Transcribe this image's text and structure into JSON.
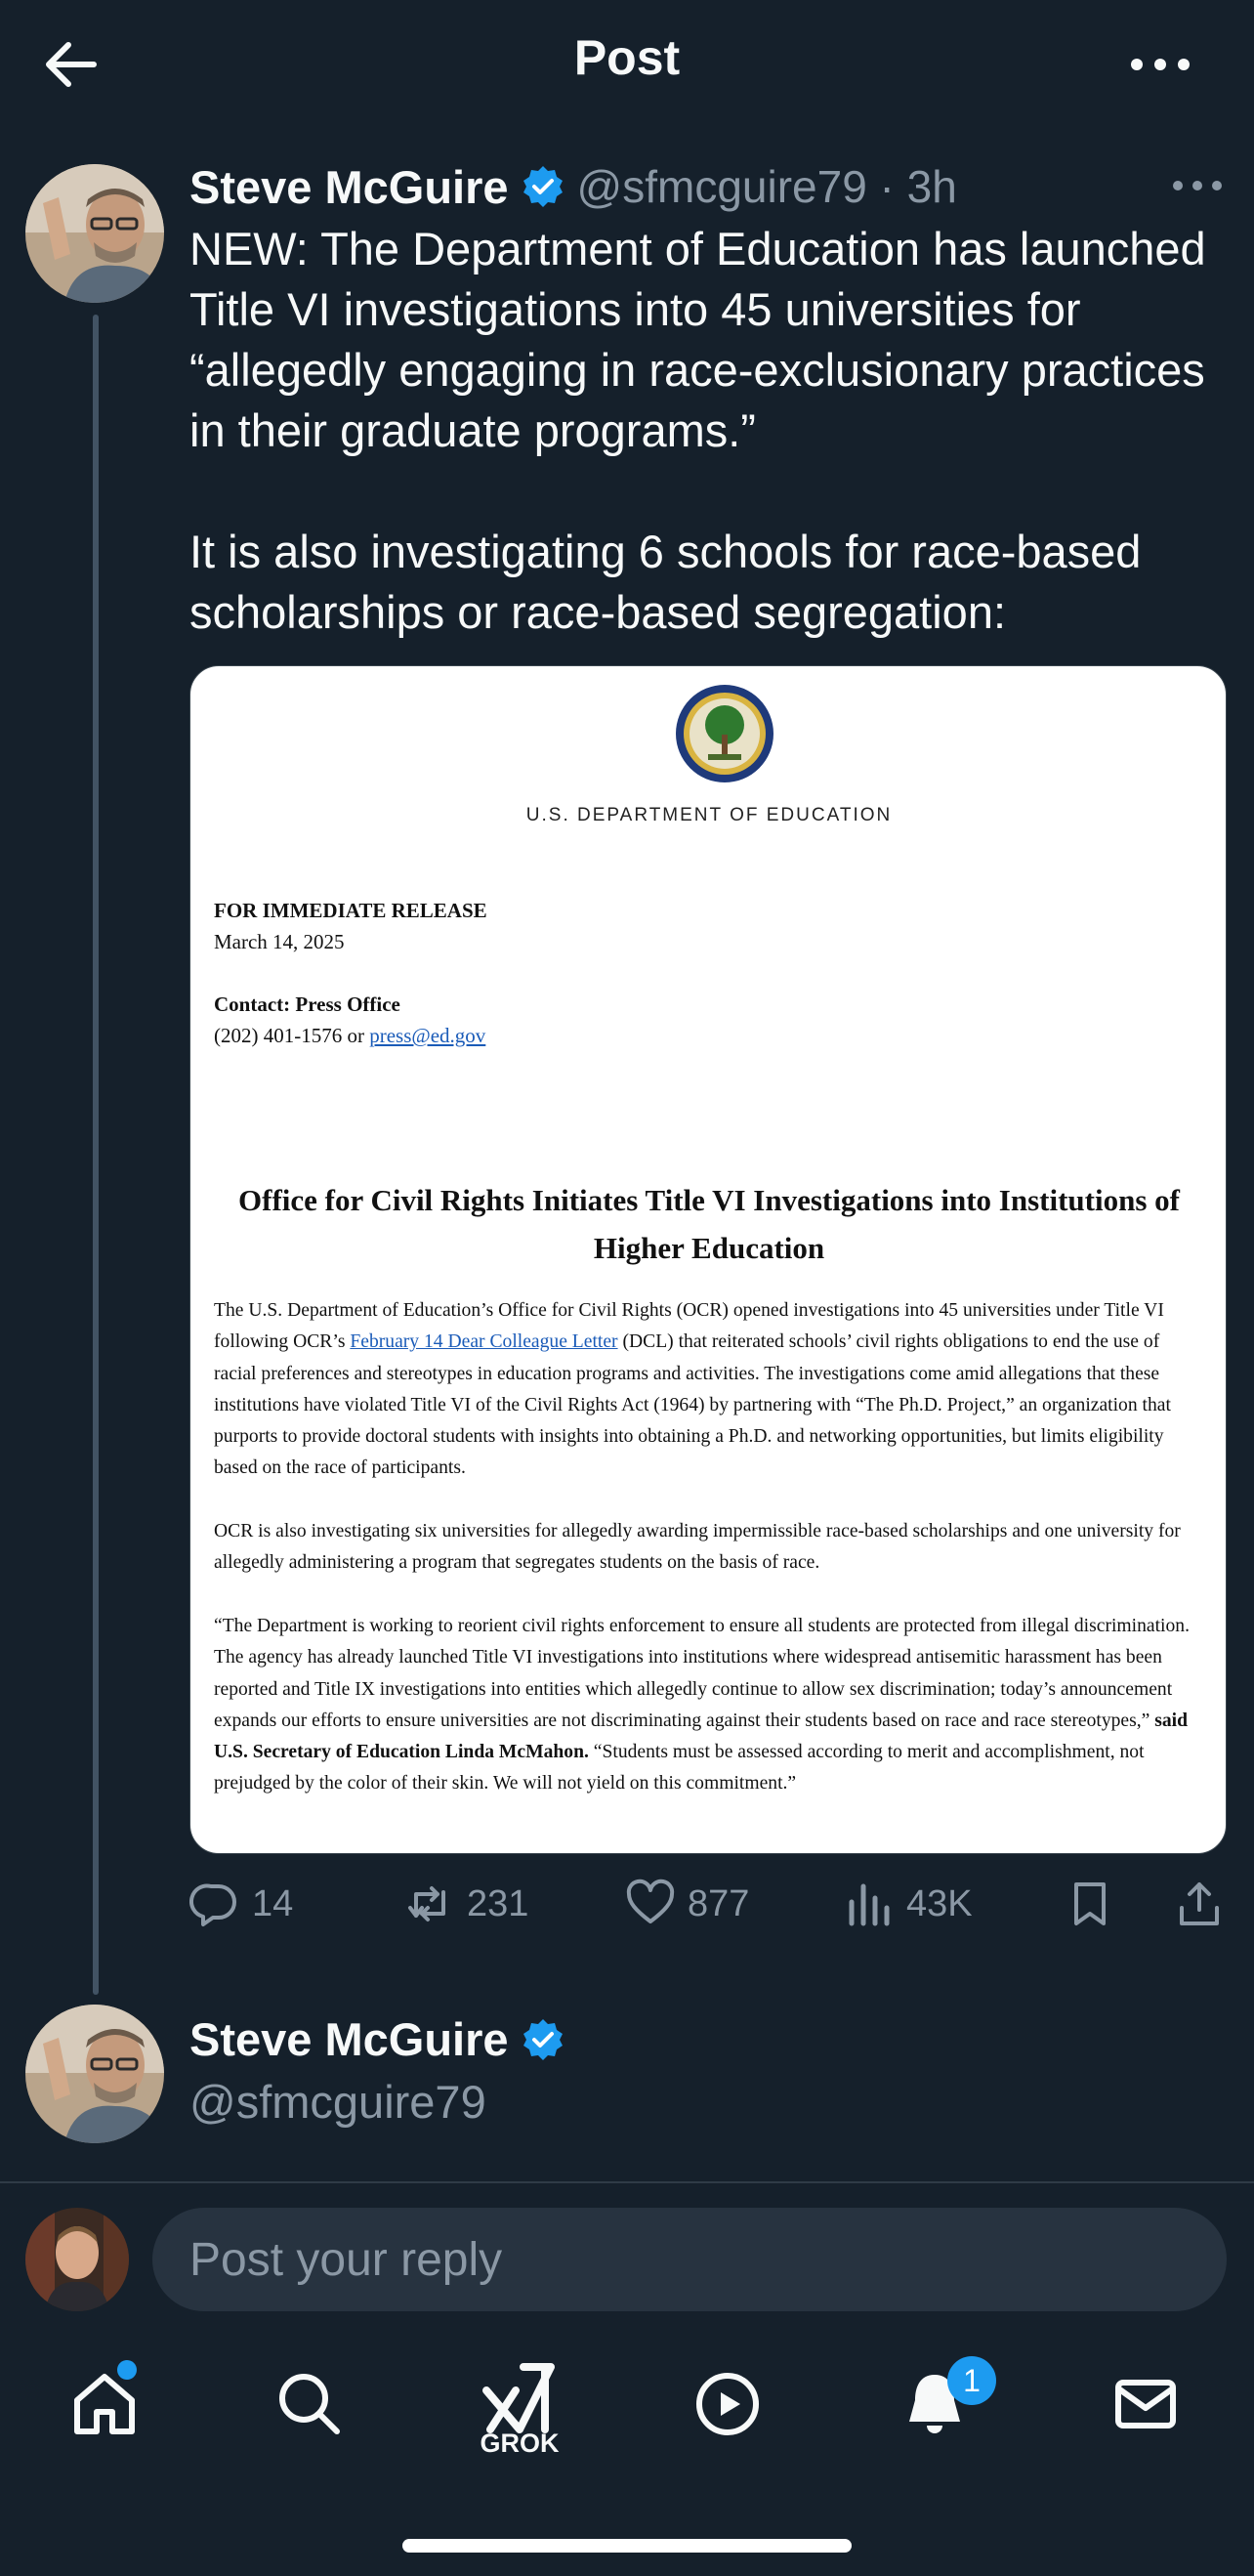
{
  "header": {
    "title": "Post"
  },
  "tweet": {
    "author_name": "Steve McGuire",
    "handle_meta": "@sfmcguire79 · 3h",
    "text": "NEW: The Department of Education has launched Title VI investigations into 45 universities for “allegedly engaging in race-exclusionary practices in their graduate programs.”\n\nIt is also investigating 6 schools for race-based scholarships or race-based segregation:",
    "document": {
      "department": "U.S. DEPARTMENT OF EDUCATION",
      "release_label": "FOR IMMEDIATE RELEASE",
      "release_date": "March 14, 2025",
      "contact_label": "Contact: Press Office",
      "contact_phone": "(202) 401-1576 or",
      "contact_email": "press@ed.gov",
      "title": "Office for Civil Rights Initiates Title VI Investigations into Institutions of Higher Education",
      "p1_a": "The U.S. Department of Education’s Office for Civil Rights (OCR) opened investigations into 45 universities under Title VI following OCR’s ",
      "p1_link": "February 14 Dear Colleague Letter",
      "p1_b": " (DCL) that reiterated schools’ civil rights obligations to end the use of racial preferences and stereotypes in education programs and activities. The investigations come amid allegations that these institutions have violated Title VI of the Civil Rights Act (1964) by partnering with “The Ph.D. Project,” an organization that purports to provide doctoral students with insights into obtaining a Ph.D. and networking opportunities, but limits eligibility based on the race of participants.",
      "p2": "OCR is also investigating six universities for allegedly awarding impermissible race-based scholarships and one university for allegedly administering a program that segregates students on the basis of race.",
      "p3_a": "“The Department is working to reorient civil rights enforcement to ensure all students are protected from illegal discrimination. The agency has already launched Title VI investigations into institutions where widespread antisemitic harassment has been reported and Title IX investigations into entities which allegedly continue to allow sex discrimination; today’s announcement expands our efforts to ensure universities are not discriminating against their students based on race and race stereotypes,” ",
      "p3_bold": "said U.S. Secretary of Education Linda McMahon.",
      "p3_b": " “Students must be assessed according to merit and accomplishment, not prejudged by the color of their skin. We will not yield on this commitment.”"
    },
    "metrics": {
      "replies": "14",
      "reposts": "231",
      "likes": "877",
      "views": "43K"
    }
  },
  "reply_tweet": {
    "author_name": "Steve McGuire",
    "handle": "@sfmcguire79"
  },
  "reply_bar": {
    "placeholder": "Post your reply"
  },
  "nav": {
    "grok_label": "GROK",
    "notifications_count": "1"
  },
  "colors": {
    "background": "#15202b",
    "accent": "#1d9bf0",
    "muted": "#8b98a5"
  }
}
